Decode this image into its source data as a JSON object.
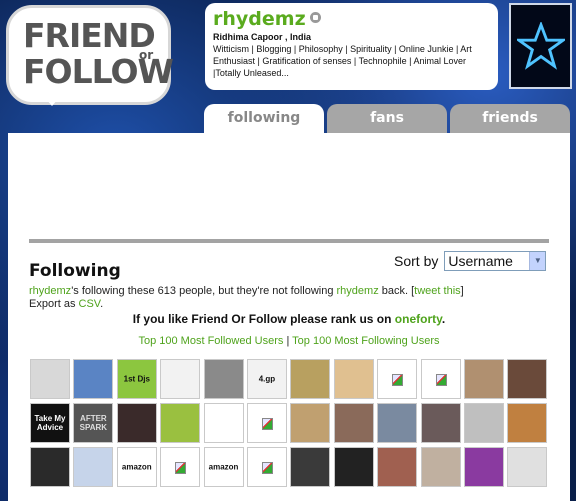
{
  "logo": {
    "line1": "FRIEND",
    "or": "or",
    "line2": "FOLLOW"
  },
  "profile": {
    "username": "rhydemz",
    "real_name": "Ridhima Capoor , India",
    "bio": "Witticism | Blogging | Philosophy | Spirituality | Online Junkie | Art Enthusiast | Gratification of senses | Technophile | Animal Lover |Totally Unleased..."
  },
  "tabs": [
    {
      "label": "following",
      "active": true
    },
    {
      "label": "fans",
      "active": false
    },
    {
      "label": "friends",
      "active": false
    }
  ],
  "main": {
    "heading": "Following",
    "sort_label": "Sort by",
    "sort_value": "Username",
    "desc_user": "rhydemz",
    "desc_mid": "'s following these 613 people, but they're not following ",
    "desc_user2": "rhydemz",
    "desc_back": " back. [",
    "desc_tweet": "tweet this",
    "desc_close": "]",
    "export_label": "Export as ",
    "export_link": "CSV",
    "export_end": ".",
    "rank_text": "If you like Friend Or Follow please rank us on ",
    "rank_link": "oneforty",
    "rank_end": ".",
    "top_followed": "Top 100 Most Followed Users",
    "top_following": "Top 100 Most Following Users"
  },
  "colors": {
    "accent_green": "#4fa31c",
    "tab_gray": "#a6a6a6",
    "background": "#0a1f4a"
  },
  "grid": [
    {
      "bg": "#d8d8d8",
      "text": "",
      "fg": "#333"
    },
    {
      "bg": "#5a84c4",
      "text": "",
      "fg": "#fff"
    },
    {
      "bg": "#8cc63f",
      "text": "1st Djs",
      "fg": "#111"
    },
    {
      "bg": "#f2f2f2",
      "text": "",
      "fg": "#c33"
    },
    {
      "bg": "#8a8a8a",
      "text": "",
      "fg": "#fff"
    },
    {
      "bg": "#f2f2f2",
      "text": "4.gp",
      "fg": "#111"
    },
    {
      "bg": "#b8a060",
      "text": "",
      "fg": "#fff"
    },
    {
      "bg": "#e0c090",
      "text": "",
      "fg": "#fff"
    },
    {
      "bg": "broken",
      "text": "",
      "fg": ""
    },
    {
      "bg": "broken",
      "text": "",
      "fg": ""
    },
    {
      "bg": "#b09070",
      "text": "",
      "fg": "#fff"
    },
    {
      "bg": "#6a4a3a",
      "text": "",
      "fg": "#fff"
    },
    {
      "bg": "#111111",
      "text": "Take My Advice",
      "fg": "#fff"
    },
    {
      "bg": "#555555",
      "text": "AFTER SPARK",
      "fg": "#ddd"
    },
    {
      "bg": "#3a2a2a",
      "text": "",
      "fg": "#fff"
    },
    {
      "bg": "#9ac040",
      "text": "",
      "fg": "#fff"
    },
    {
      "bg": "#ffffff",
      "text": "",
      "fg": "#c33"
    },
    {
      "bg": "broken",
      "text": "",
      "fg": ""
    },
    {
      "bg": "#c0a070",
      "text": "",
      "fg": "#fff"
    },
    {
      "bg": "#8a6a5a",
      "text": "",
      "fg": "#fff"
    },
    {
      "bg": "#7a8aa0",
      "text": "",
      "fg": "#fff"
    },
    {
      "bg": "#6a5a5a",
      "text": "",
      "fg": "#fff"
    },
    {
      "bg": "#bfbfbf",
      "text": "",
      "fg": "#fff"
    },
    {
      "bg": "#c08040",
      "text": "",
      "fg": "#fff"
    },
    {
      "bg": "#2a2a2a",
      "text": "",
      "fg": "#fff"
    },
    {
      "bg": "#c6d4ea",
      "text": "",
      "fg": "#333"
    },
    {
      "bg": "#ffffff",
      "text": "amazon",
      "fg": "#111"
    },
    {
      "bg": "broken",
      "text": "",
      "fg": ""
    },
    {
      "bg": "#ffffff",
      "text": "amazon",
      "fg": "#111"
    },
    {
      "bg": "broken",
      "text": "",
      "fg": ""
    },
    {
      "bg": "#3a3a3a",
      "text": "",
      "fg": "#fff"
    },
    {
      "bg": "#222222",
      "text": "",
      "fg": "#fff"
    },
    {
      "bg": "#a06050",
      "text": "",
      "fg": "#fff"
    },
    {
      "bg": "#c0b0a0",
      "text": "",
      "fg": "#fff"
    },
    {
      "bg": "#8a3aa0",
      "text": "",
      "fg": "#fff"
    },
    {
      "bg": "#e0e0e0",
      "text": "",
      "fg": "#111"
    }
  ]
}
